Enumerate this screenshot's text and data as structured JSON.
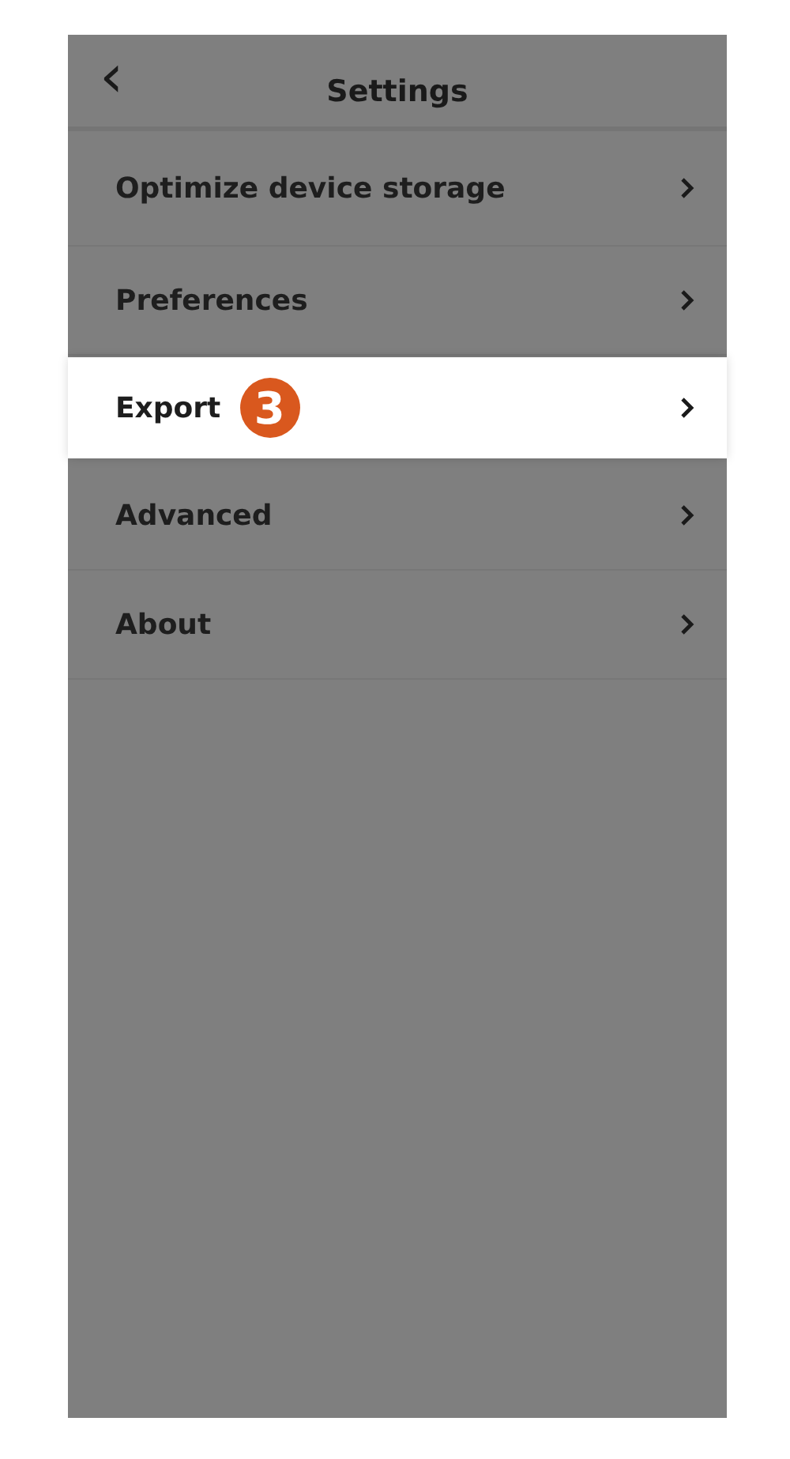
{
  "header": {
    "back": "‹",
    "title": "Settings"
  },
  "items": [
    {
      "label": "Optimize device storage",
      "highlighted": false
    },
    {
      "label": "Preferences",
      "highlighted": false
    },
    {
      "label": "Export",
      "highlighted": true,
      "badge": "3"
    },
    {
      "label": "Advanced",
      "highlighted": false
    },
    {
      "label": "About",
      "highlighted": false
    }
  ]
}
